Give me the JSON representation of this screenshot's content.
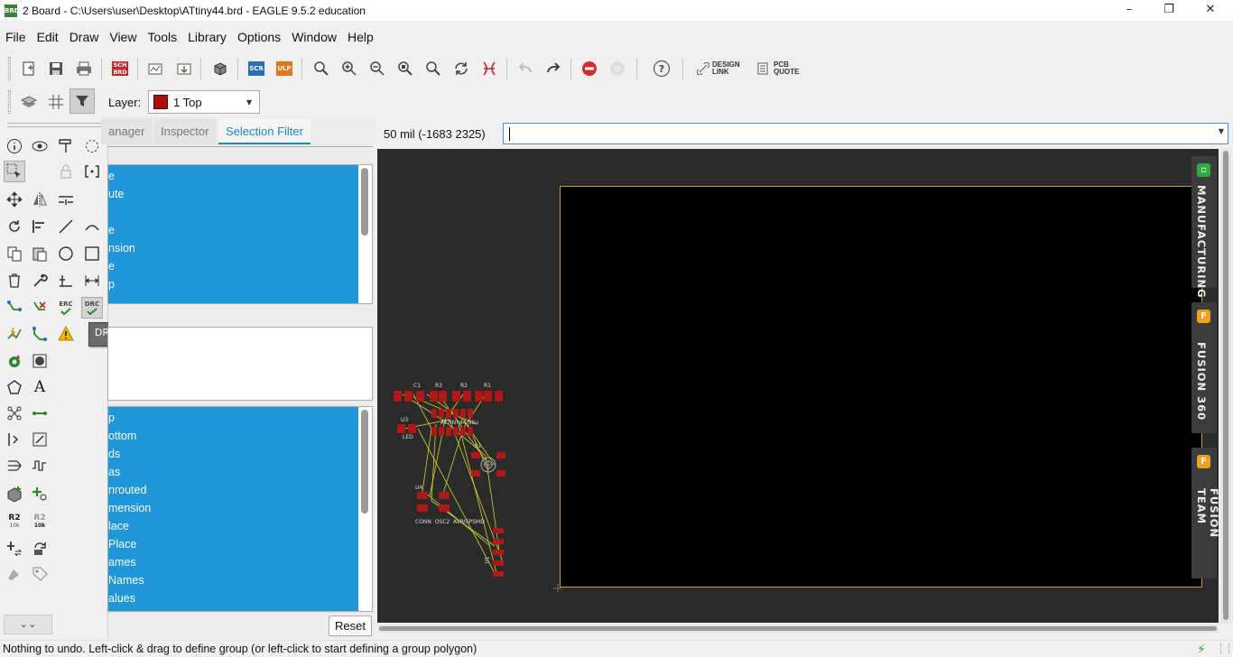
{
  "window": {
    "title": "2 Board - C:\\Users\\user\\Desktop\\ATtiny44.brd - EAGLE 9.5.2 education",
    "icon_text": "BRD",
    "minimize": "–",
    "maximize": "❐",
    "close": "✕"
  },
  "menu": [
    "File",
    "Edit",
    "Draw",
    "View",
    "Tools",
    "Library",
    "Options",
    "Window",
    "Help"
  ],
  "toolbar": {
    "sch_brd": "SCH BRD",
    "scr": "SCR",
    "ulp": "ULP",
    "design_link": "DESIGN LINK",
    "pcb_quote": "PCB QUOTE",
    "help": "?"
  },
  "layer": {
    "label": "Layer:",
    "value": "1 Top",
    "color": "#a81010"
  },
  "palette": {
    "erc": "ERC",
    "drc": "DRC",
    "r2": "R2",
    "r2_sub": "10k",
    "text_tool": "A",
    "tooltip": "DRC"
  },
  "panel": {
    "tabs": [
      "anager",
      "Inspector",
      "Selection Filter"
    ],
    "list1": [
      "e",
      "ute",
      "",
      "e",
      "nsion",
      "e",
      "p"
    ],
    "list3": [
      "p",
      "ottom",
      "ds",
      "as",
      "nrouted",
      "mension",
      "lace",
      "Place",
      "ames",
      "Names",
      "alues"
    ],
    "reset": "Reset"
  },
  "canvas": {
    "coord": "50 mil (-1683 2325)",
    "command": "",
    "sidetabs": [
      {
        "label": "MANUFACTURING",
        "icon_color": "#2eaa3e"
      },
      {
        "label": "FUSION 360",
        "icon_color": "#f0a020"
      },
      {
        "label": "FUSION TEAM",
        "icon_color": "#f0a020"
      }
    ],
    "part_labels": {
      "c1": "C1",
      "r3": "R3",
      "r2": "R2",
      "r1": "R1",
      "u3": "U3",
      "led": "LED",
      "chip": "ATTINY44-SSu",
      "s1": "S1",
      "u4": "U4",
      "conn": "CONN  OSC2  AVRISPSMD",
      "u1": "U1"
    }
  },
  "status": {
    "text": "Nothing to undo. Left-click & drag to define group (or left-click to start defining a group polygon)",
    "icon": "⚡"
  }
}
